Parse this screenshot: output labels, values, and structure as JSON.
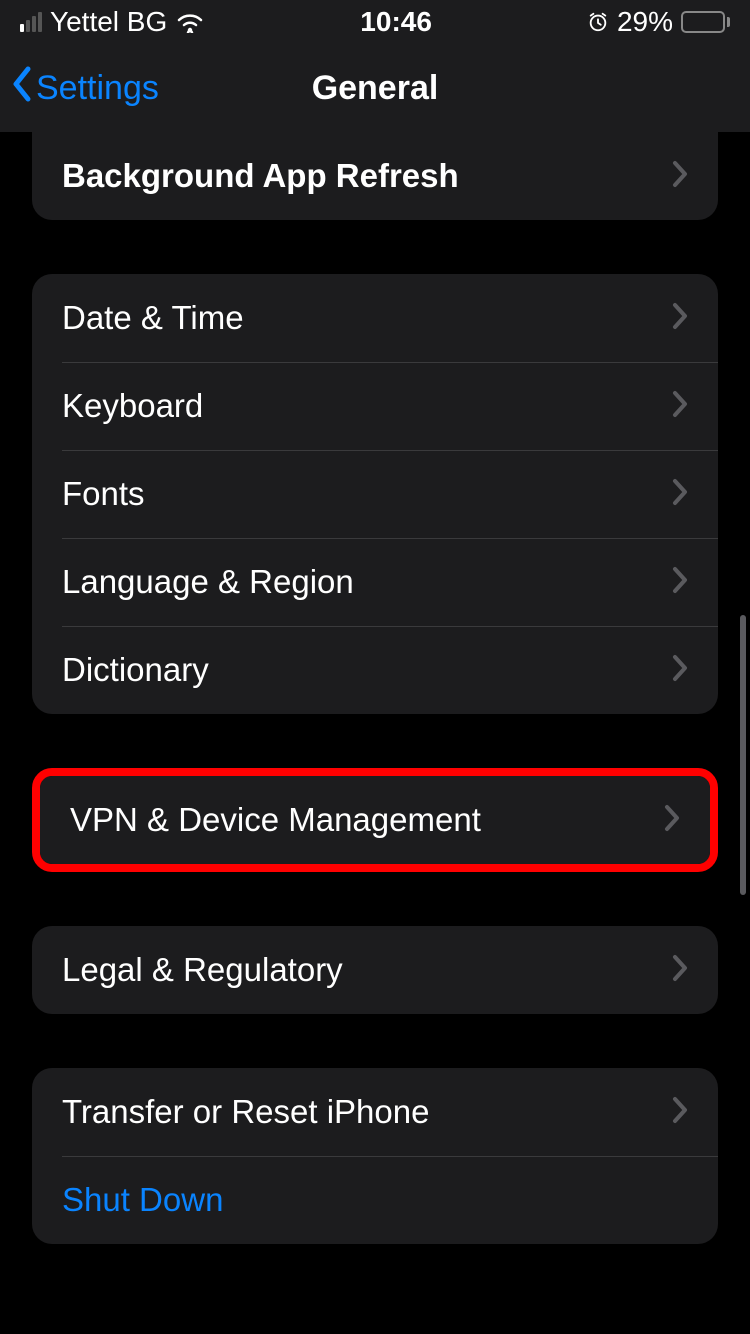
{
  "status_bar": {
    "carrier": "Yettel BG",
    "time": "10:46",
    "battery_percent": "29%"
  },
  "nav": {
    "back_label": "Settings",
    "title": "General"
  },
  "sections": {
    "s0": {
      "items": [
        {
          "label": "Background App Refresh"
        }
      ]
    },
    "s1": {
      "items": [
        {
          "label": "Date & Time"
        },
        {
          "label": "Keyboard"
        },
        {
          "label": "Fonts"
        },
        {
          "label": "Language & Region"
        },
        {
          "label": "Dictionary"
        }
      ]
    },
    "s2": {
      "items": [
        {
          "label": "VPN & Device Management"
        }
      ]
    },
    "s3": {
      "items": [
        {
          "label": "Legal & Regulatory"
        }
      ]
    },
    "s4": {
      "items": [
        {
          "label": "Transfer or Reset iPhone"
        },
        {
          "label": "Shut Down"
        }
      ]
    }
  }
}
